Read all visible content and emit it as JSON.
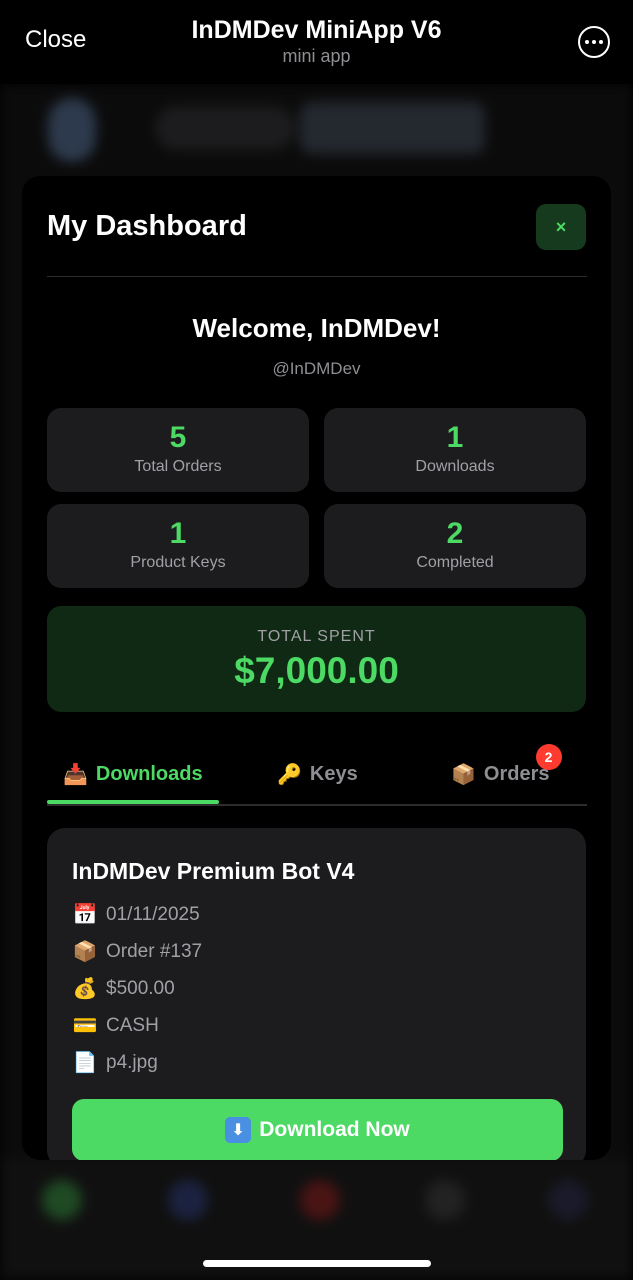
{
  "header": {
    "close_label": "Close",
    "title": "InDMDev MiniApp V6",
    "subtitle": "mini app",
    "more_icon": "more-horizontal-icon"
  },
  "dashboard": {
    "title": "My Dashboard",
    "close_symbol": "×",
    "welcome": "Welcome, InDMDev!",
    "handle": "@InDMDev",
    "stats": [
      {
        "value": "5",
        "label": "Total Orders"
      },
      {
        "value": "1",
        "label": "Downloads"
      },
      {
        "value": "1",
        "label": "Product Keys"
      },
      {
        "value": "2",
        "label": "Completed"
      }
    ],
    "total_spent_label": "TOTAL SPENT",
    "total_spent_value": "$7,000.00",
    "tabs": [
      {
        "icon": "📥",
        "label": "Downloads",
        "active": true
      },
      {
        "icon": "🔑",
        "label": "Keys",
        "active": false
      },
      {
        "icon": "📦",
        "label": "Orders",
        "active": false,
        "badge": "2"
      }
    ],
    "download_card": {
      "title": "InDMDev Premium Bot V4",
      "date": "01/11/2025",
      "order": "Order #137",
      "price": "$500.00",
      "payment": "CASH",
      "file": "p4.jpg",
      "button_icon": "⬇",
      "button_label": "Download Now"
    },
    "icons": {
      "date": "📅",
      "order": "📦",
      "price": "💰",
      "payment": "💳",
      "file": "📄"
    }
  },
  "colors": {
    "accent": "#4cd964",
    "badge": "#ff3b30",
    "card": "#1c1c1e"
  }
}
